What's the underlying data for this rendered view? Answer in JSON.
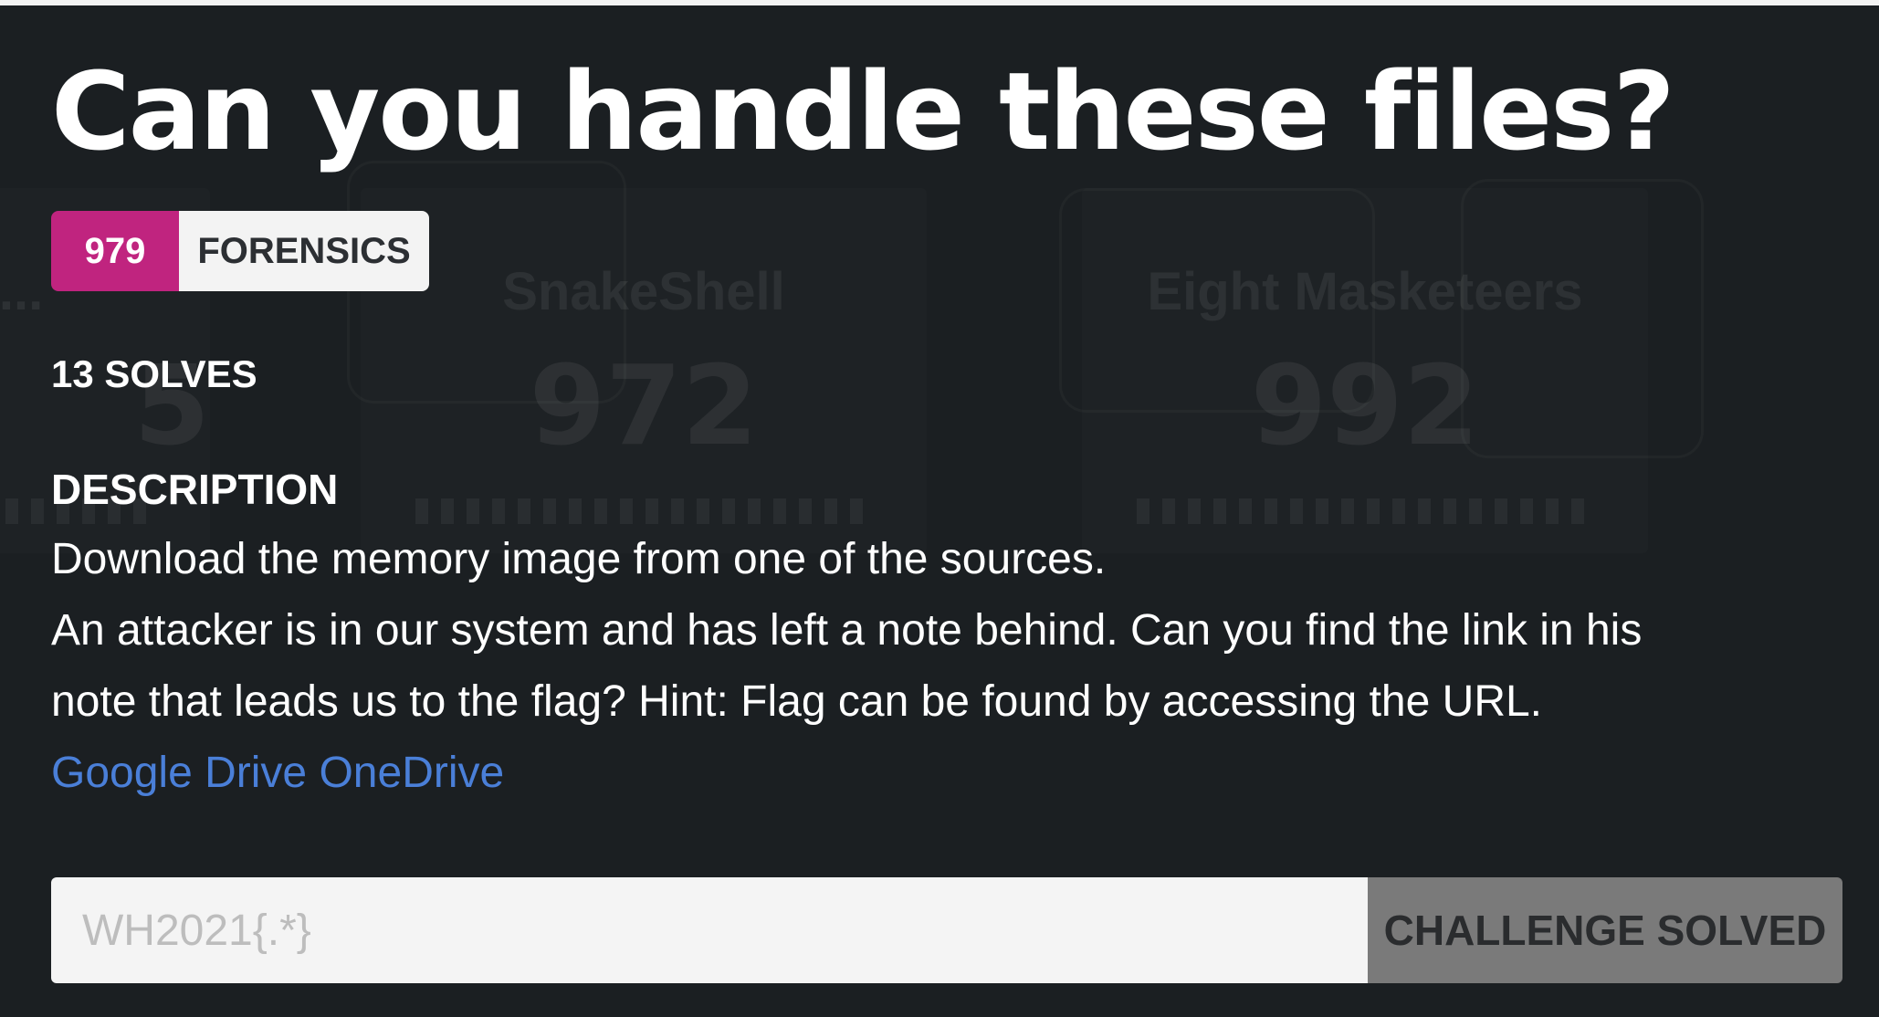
{
  "background_cards": [
    {
      "name": "ts the L...",
      "points": "5"
    },
    {
      "name": "SnakeShell",
      "points": "972"
    },
    {
      "name": "Eight Masketeers",
      "points": "992"
    }
  ],
  "challenge": {
    "title": "Can you handle these files?",
    "points": "979",
    "category": "FORENSICS",
    "solves": "13 SOLVES",
    "description_heading": "DESCRIPTION",
    "description_line_1": "Download the memory image from one of the sources.",
    "description_line_2": "An attacker is in our system and has left a note behind. Can you find the link in his",
    "description_line_3": "note that leads us to the flag? Hint: Flag can be found by accessing the URL.",
    "links": [
      {
        "label": "Google Drive"
      },
      {
        "label": "OneDrive"
      }
    ]
  },
  "flag_form": {
    "placeholder": "WH2021{.*}",
    "value": "",
    "button_label": "CHALLENGE SOLVED"
  },
  "colors": {
    "background": "#1b1f22",
    "points_badge": "#c0247f",
    "category_badge": "#f3f3f3",
    "link": "#4a7fd8",
    "solved_button": "#7a7a7a"
  }
}
